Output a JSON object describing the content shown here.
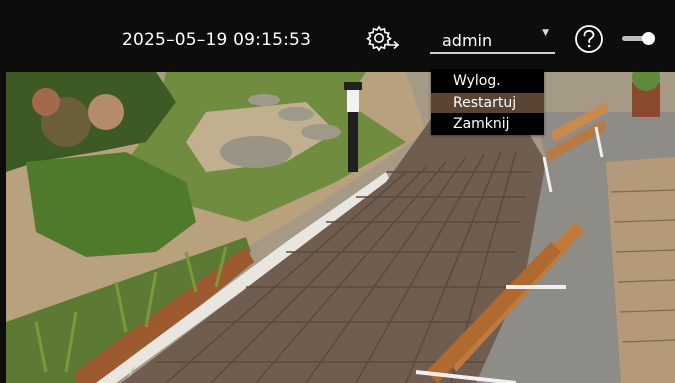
{
  "header": {
    "datetime": "2025–05–19 09:15:53",
    "settings_icon": "gear-arrow-icon",
    "user_select": {
      "value": "admin",
      "caret_icon": "caret-down-icon"
    },
    "help_icon": "question-circle-icon",
    "toggle": {
      "state": "on"
    }
  },
  "user_menu": {
    "items": [
      {
        "label": "Wylog."
      },
      {
        "label": "Restartuj",
        "highlighted": true
      },
      {
        "label": "Zamknij"
      }
    ]
  },
  "video": {
    "description_icon": "camera-feed-image"
  },
  "colors": {
    "bar": "#0d0d0d",
    "text": "#ffffff",
    "menu_highlight": "#5a4535"
  }
}
